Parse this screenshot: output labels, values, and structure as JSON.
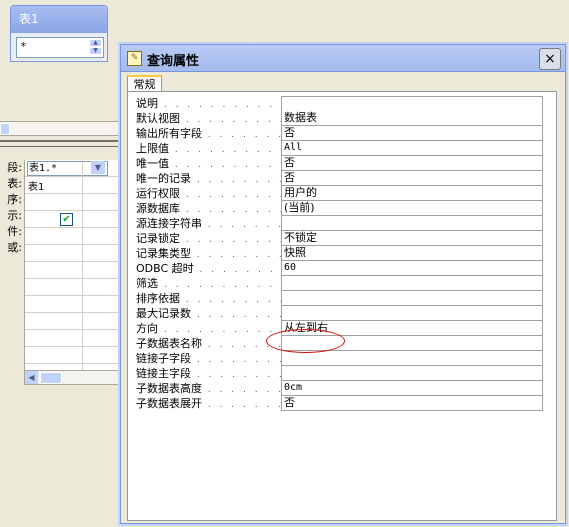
{
  "table_window": {
    "title": "表1",
    "field_item": "*"
  },
  "grid": {
    "row_labels": [
      "段:",
      "表:",
      "序:",
      "示:",
      "件:",
      "或:"
    ],
    "field_value": "表1.*",
    "table_value": "表1"
  },
  "dialog": {
    "title": "查询属性",
    "close_label": "×",
    "tab_label": "常规",
    "properties": [
      {
        "name": "说明",
        "value": ""
      },
      {
        "name": "默认视图",
        "value": "数据表"
      },
      {
        "name": "输出所有字段",
        "value": "否"
      },
      {
        "name": "上限值",
        "value": "All"
      },
      {
        "name": "唯一值",
        "value": "否"
      },
      {
        "name": "唯一的记录",
        "value": "否"
      },
      {
        "name": "运行权限",
        "value": "用户的"
      },
      {
        "name": "源数据库",
        "value": "(当前)"
      },
      {
        "name": "源连接字符串",
        "value": ""
      },
      {
        "name": "记录锁定",
        "value": "不锁定"
      },
      {
        "name": "记录集类型",
        "value": "快照"
      },
      {
        "name": "ODBC 超时",
        "value": "60"
      },
      {
        "name": "筛选",
        "value": ""
      },
      {
        "name": "排序依据",
        "value": ""
      },
      {
        "name": "最大记录数",
        "value": ""
      },
      {
        "name": "方向",
        "value": "从左到右"
      },
      {
        "name": "子数据表名称",
        "value": ""
      },
      {
        "name": "链接子字段",
        "value": ""
      },
      {
        "name": "链接主字段",
        "value": ""
      },
      {
        "name": "子数据表高度",
        "value": "0cm"
      },
      {
        "name": "子数据表展开",
        "value": "否"
      }
    ]
  }
}
